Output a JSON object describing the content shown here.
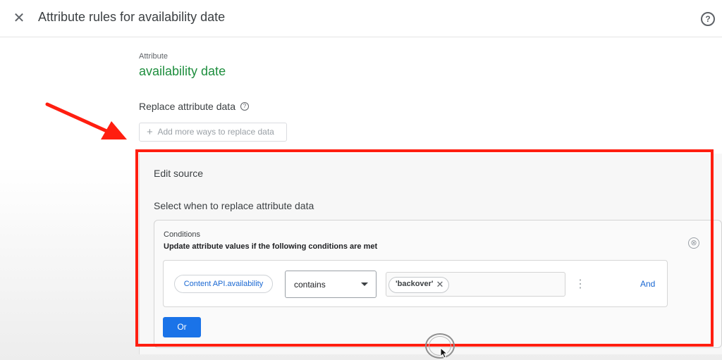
{
  "header": {
    "close_icon": "close-icon",
    "close_glyph": "✕",
    "title": "Attribute rules for availability date",
    "help_icon": "help-icon",
    "help_glyph": "?"
  },
  "attribute": {
    "label": "Attribute",
    "name": "availability date"
  },
  "replace": {
    "label": "Replace attribute data",
    "help_glyph": "?",
    "add_icon_glyph": "+",
    "add_button": "Add more ways to replace data"
  },
  "edit_source": {
    "title": "Edit source",
    "select_when": "Select when to replace attribute data",
    "conditions": {
      "label": "Conditions",
      "description": "Update attribute values if the following conditions are met",
      "remove_glyph": "⊗",
      "rule": {
        "field": "Content API.availability",
        "operator": "contains",
        "value_chip": "'backover'",
        "chip_remove_glyph": "✕",
        "more_glyph": "⋮",
        "and_label": "And"
      }
    },
    "or_button": "Or"
  },
  "colors": {
    "attribute_name": "#1e8e3e",
    "link": "#1967d2",
    "primary_button": "#1a73e8",
    "annotation_red": "#ff1e10"
  }
}
